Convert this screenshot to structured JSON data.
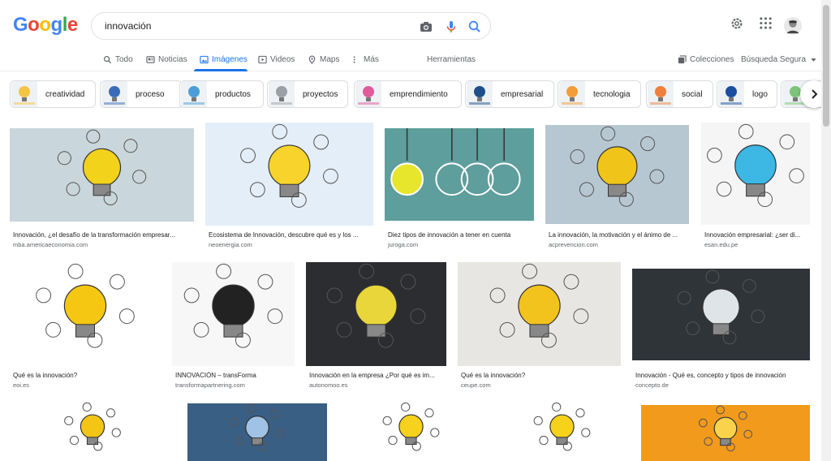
{
  "search": {
    "query": "innovación"
  },
  "logo": {
    "letters": [
      {
        "ch": "G",
        "color": "#4285f4"
      },
      {
        "ch": "o",
        "color": "#ea4335"
      },
      {
        "ch": "o",
        "color": "#fbbc05"
      },
      {
        "ch": "g",
        "color": "#4285f4"
      },
      {
        "ch": "l",
        "color": "#34a853"
      },
      {
        "ch": "e",
        "color": "#ea4335"
      }
    ]
  },
  "tabs": [
    {
      "label": "Todo",
      "icon": "search-icon"
    },
    {
      "label": "Noticias",
      "icon": "news-icon"
    },
    {
      "label": "Imágenes",
      "icon": "image-icon",
      "active": true
    },
    {
      "label": "Videos",
      "icon": "video-icon"
    },
    {
      "label": "Maps",
      "icon": "map-pin-icon"
    },
    {
      "label": "Más",
      "icon": "more-vert-icon"
    }
  ],
  "tools": {
    "herramientas": "Herramientas",
    "colecciones": "Colecciones",
    "safe_search": "Búsqueda Segura"
  },
  "chips": [
    {
      "label": "creatividad",
      "color": "#f4c542"
    },
    {
      "label": "proceso",
      "color": "#3b6cb8"
    },
    {
      "label": "productos",
      "color": "#4a9fd8"
    },
    {
      "label": "proyectos",
      "color": "#9aa0a6"
    },
    {
      "label": "emprendimiento",
      "color": "#e05a9c"
    },
    {
      "label": "empresarial",
      "color": "#1f4f8a"
    },
    {
      "label": "tecnologia",
      "color": "#f29d38"
    },
    {
      "label": "social",
      "color": "#f07f3c"
    },
    {
      "label": "logo",
      "color": "#1a4fa0"
    },
    {
      "label": "",
      "color": "#7cc576"
    }
  ],
  "results": [
    {
      "title": "Innovación, ¿el desafío de la transformación empresar...",
      "source": "mba.americaeconomia.com",
      "bg": "#c9d6dc",
      "accent": "#f2d21b"
    },
    {
      "title": "Ecosistema de Innovación, descubre qué es y los ...",
      "source": "neoenergia.com",
      "bg": "#e3eef8",
      "accent": "#f7d32b"
    },
    {
      "title": "Diez tipos de innovación a tener en cuenta",
      "source": "juroga.com",
      "bg": "#5e9e9c",
      "accent": "#e8e62c"
    },
    {
      "title": "La innovación, la motivación y el ánimo de ...",
      "source": "acprevencion.com",
      "bg": "#b7c7d2",
      "accent": "#f0c419"
    },
    {
      "title": "Innovación empresarial: ¿ser di...",
      "source": "esan.edu.pe",
      "bg": "#f5f5f5",
      "accent": "#3db7e4"
    },
    {
      "title": "Qué es la innovación?",
      "source": "eoi.es",
      "bg": "#ffffff",
      "accent": "#f6c712"
    },
    {
      "title": "INNOVACIÓN – transForma",
      "source": "transformapartnering.com",
      "bg": "#f7f7f7",
      "accent": "#222222"
    },
    {
      "title": "Innovación en la empresa ¿Por qué es im...",
      "source": "autonomoo.es",
      "bg": "#2b2d30",
      "accent": "#e9d63a"
    },
    {
      "title": "Qué es la innovación?",
      "source": "ceupe.com",
      "bg": "#e8e6e2",
      "accent": "#f2c31d"
    },
    {
      "title": "Innovación - Qué es, concepto y tipos de innovación",
      "source": "concepto.de",
      "bg": "#2f3439",
      "accent": "#dfe4e8"
    },
    {
      "title": "",
      "source": "",
      "bg": "#ffffff",
      "accent": "#f3c515"
    },
    {
      "title": "",
      "source": "",
      "bg": "#3a5f85",
      "accent": "#9fc3e6"
    },
    {
      "title": "",
      "source": "",
      "bg": "#ffffff",
      "accent": "#f6d11d"
    },
    {
      "title": "",
      "source": "",
      "bg": "#ffffff",
      "accent": "#f7d21a"
    },
    {
      "title": "",
      "source": "",
      "bg": "#f29a1c",
      "accent": "#fbd34b"
    }
  ]
}
